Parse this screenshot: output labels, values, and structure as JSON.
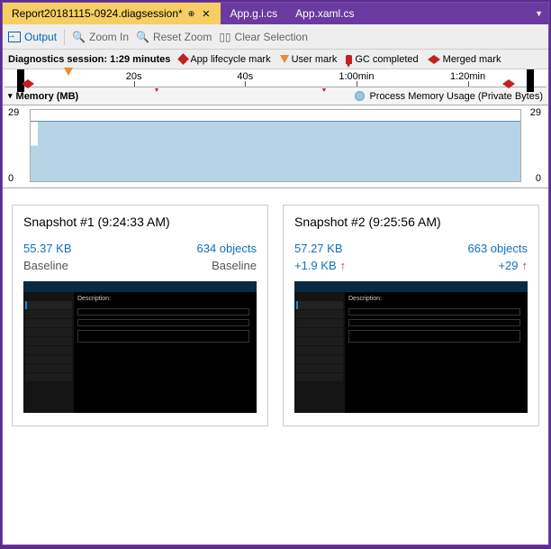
{
  "tabs": [
    {
      "label": "Report20181115-0924.diagsession*",
      "active": true
    },
    {
      "label": "App.g.i.cs",
      "active": false
    },
    {
      "label": "App.xaml.cs",
      "active": false
    }
  ],
  "toolbar": {
    "output": "Output",
    "zoom_in": "Zoom In",
    "reset_zoom": "Reset Zoom",
    "clear_selection": "Clear Selection"
  },
  "session_label": "Diagnostics session: ",
  "session_duration": "1:29 minutes",
  "marks": {
    "lifecycle": "App lifecycle mark",
    "user": "User mark",
    "gc": "GC completed",
    "merged": "Merged mark"
  },
  "ruler": [
    "20s",
    "40s",
    "1:00min",
    "1:20min"
  ],
  "memory_title": "Memory (MB)",
  "legend": "Process Memory Usage (Private Bytes)",
  "y_top": "29",
  "y_bot": "0",
  "chart_data": {
    "type": "area",
    "title": "Memory (MB)",
    "xlabel": "time",
    "ylabel": "MB",
    "ylim": [
      0,
      29
    ],
    "x": [
      "0s",
      "20s",
      "40s",
      "60s",
      "80s",
      "89s"
    ],
    "values": [
      0,
      27,
      27,
      27,
      28,
      28
    ],
    "series_name": "Process Memory Usage (Private Bytes)"
  },
  "snapshots": [
    {
      "title": "Snapshot #1  (9:24:33 AM)",
      "size": "55.37 KB",
      "objects": "634 objects",
      "sub_left": "Baseline",
      "sub_right": "Baseline",
      "delta": false
    },
    {
      "title": "Snapshot #2  (9:25:56 AM)",
      "size": "57.27 KB",
      "objects": "663 objects",
      "sub_left": "+1.9 KB",
      "sub_right": "+29",
      "delta": true
    }
  ]
}
